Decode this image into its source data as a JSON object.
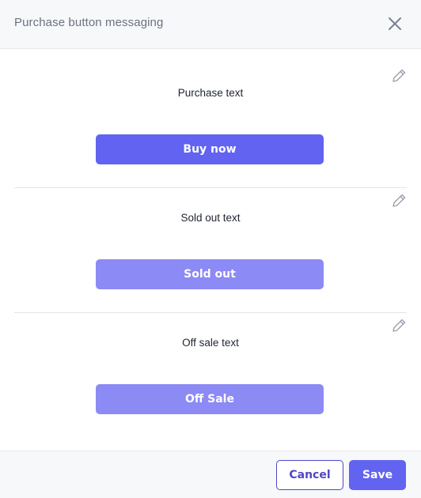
{
  "header": {
    "title": "Purchase button messaging",
    "close_icon": "close-icon"
  },
  "sections": [
    {
      "label": "Purchase text",
      "button_text": "Buy now",
      "button_color": "#6263f0",
      "edit_icon": "pencil-icon"
    },
    {
      "label": "Sold out text",
      "button_text": "Sold out",
      "button_color": "#8c8af4",
      "edit_icon": "pencil-icon"
    },
    {
      "label": "Off sale text",
      "button_text": "Off Sale",
      "button_color": "#8c8af4",
      "edit_icon": "pencil-icon"
    }
  ],
  "footer": {
    "cancel_label": "Cancel",
    "save_label": "Save",
    "save_color": "#6263f0",
    "cancel_color": "#4f46c8"
  }
}
